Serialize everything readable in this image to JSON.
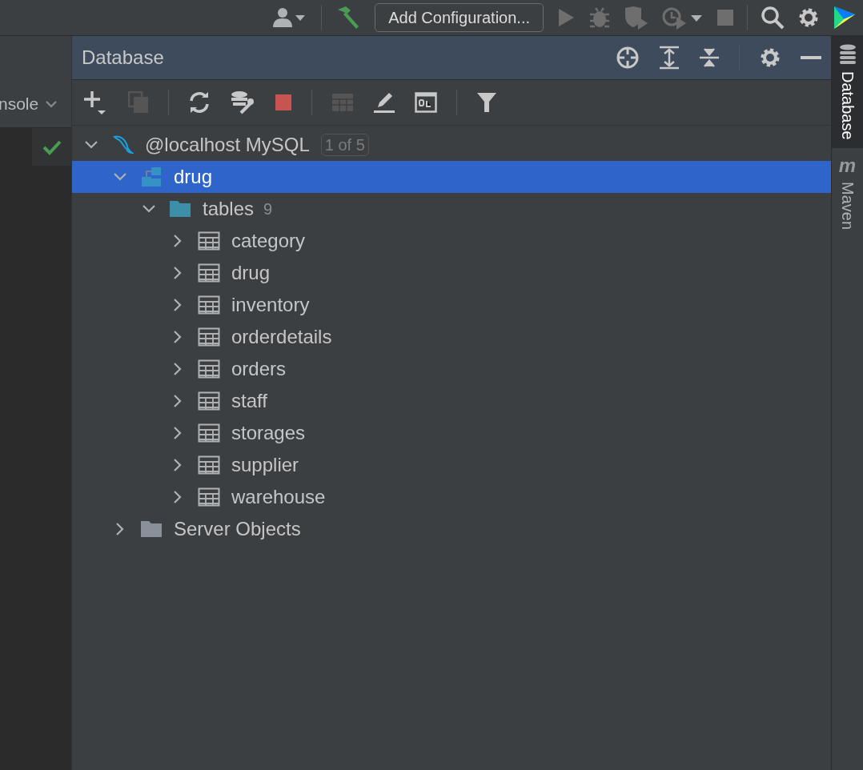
{
  "toolbar": {
    "config_button": "Add Configuration..."
  },
  "left_panel": {
    "console_tab": "nsole"
  },
  "database_panel": {
    "title": "Database",
    "tree": [
      {
        "kind": "connection",
        "label": "@localhost MySQL",
        "badge": "1 of 5",
        "expanded": true,
        "selected": false,
        "children": [
          {
            "kind": "schema",
            "label": "drug",
            "expanded": true,
            "selected": true,
            "children": [
              {
                "kind": "table-group",
                "label": "tables",
                "count": "9",
                "expanded": true,
                "selected": false,
                "children": [
                  {
                    "kind": "table",
                    "label": "category",
                    "expanded": false,
                    "selected": false
                  },
                  {
                    "kind": "table",
                    "label": "drug",
                    "expanded": false,
                    "selected": false
                  },
                  {
                    "kind": "table",
                    "label": "inventory",
                    "expanded": false,
                    "selected": false
                  },
                  {
                    "kind": "table",
                    "label": "orderdetails",
                    "expanded": false,
                    "selected": false
                  },
                  {
                    "kind": "table",
                    "label": "orders",
                    "expanded": false,
                    "selected": false
                  },
                  {
                    "kind": "table",
                    "label": "staff",
                    "expanded": false,
                    "selected": false
                  },
                  {
                    "kind": "table",
                    "label": "storages",
                    "expanded": false,
                    "selected": false
                  },
                  {
                    "kind": "table",
                    "label": "supplier",
                    "expanded": false,
                    "selected": false
                  },
                  {
                    "kind": "table",
                    "label": "warehouse",
                    "expanded": false,
                    "selected": false
                  }
                ]
              }
            ]
          },
          {
            "kind": "folder",
            "label": "Server Objects",
            "expanded": false,
            "selected": false
          }
        ]
      }
    ]
  },
  "right_strip": {
    "tabs": [
      {
        "kind": "database",
        "label": "Database",
        "selected": true
      },
      {
        "kind": "maven",
        "glyph": "m",
        "label": "Maven",
        "selected": false
      }
    ]
  }
}
